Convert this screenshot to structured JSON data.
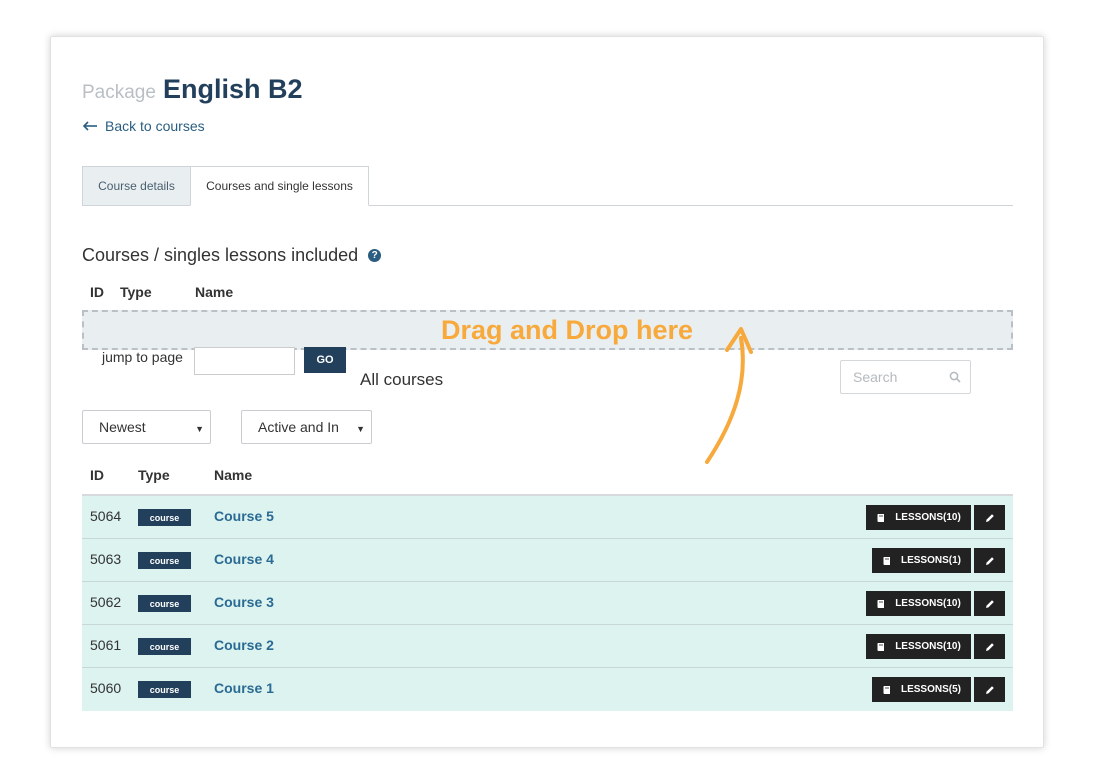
{
  "header": {
    "package_label": "Package",
    "package_name": "English B2",
    "back_label": "Back to courses"
  },
  "tabs": [
    {
      "label": "Course details"
    },
    {
      "label": "Courses and single lessons"
    }
  ],
  "included": {
    "title": "Courses / singles lessons included",
    "columns": [
      "ID",
      "Type",
      "Name"
    ],
    "dropzone_text": "Drag and Drop here"
  },
  "pagination": {
    "jump_label": "jump to page",
    "go_label": "GO"
  },
  "all_courses": {
    "title": "All courses",
    "search_placeholder": "Search",
    "sort_value": "Newest",
    "status_value": "Active and In",
    "columns": [
      "ID",
      "Type",
      "Name"
    ],
    "rows": [
      {
        "id": "5064",
        "type": "course",
        "name": "Course 5",
        "lessons": "LESSONS(10)"
      },
      {
        "id": "5063",
        "type": "course",
        "name": "Course 4",
        "lessons": "LESSONS(1)"
      },
      {
        "id": "5062",
        "type": "course",
        "name": "Course 3",
        "lessons": "LESSONS(10)"
      },
      {
        "id": "5061",
        "type": "course",
        "name": "Course 2",
        "lessons": "LESSONS(10)"
      },
      {
        "id": "5060",
        "type": "course",
        "name": "Course 1",
        "lessons": "LESSONS(5)"
      }
    ]
  },
  "colors": {
    "brand_dark": "#22405c",
    "link": "#2a6a93",
    "row_bg": "#dcf3f0",
    "accent_orange": "#f7a93c"
  },
  "icons": {
    "back": "arrow-left-icon",
    "help": "question-circle-icon",
    "search": "search-icon",
    "lessons": "book-icon",
    "edit": "pencil-icon",
    "annotation": "curved-arrow-icon"
  }
}
